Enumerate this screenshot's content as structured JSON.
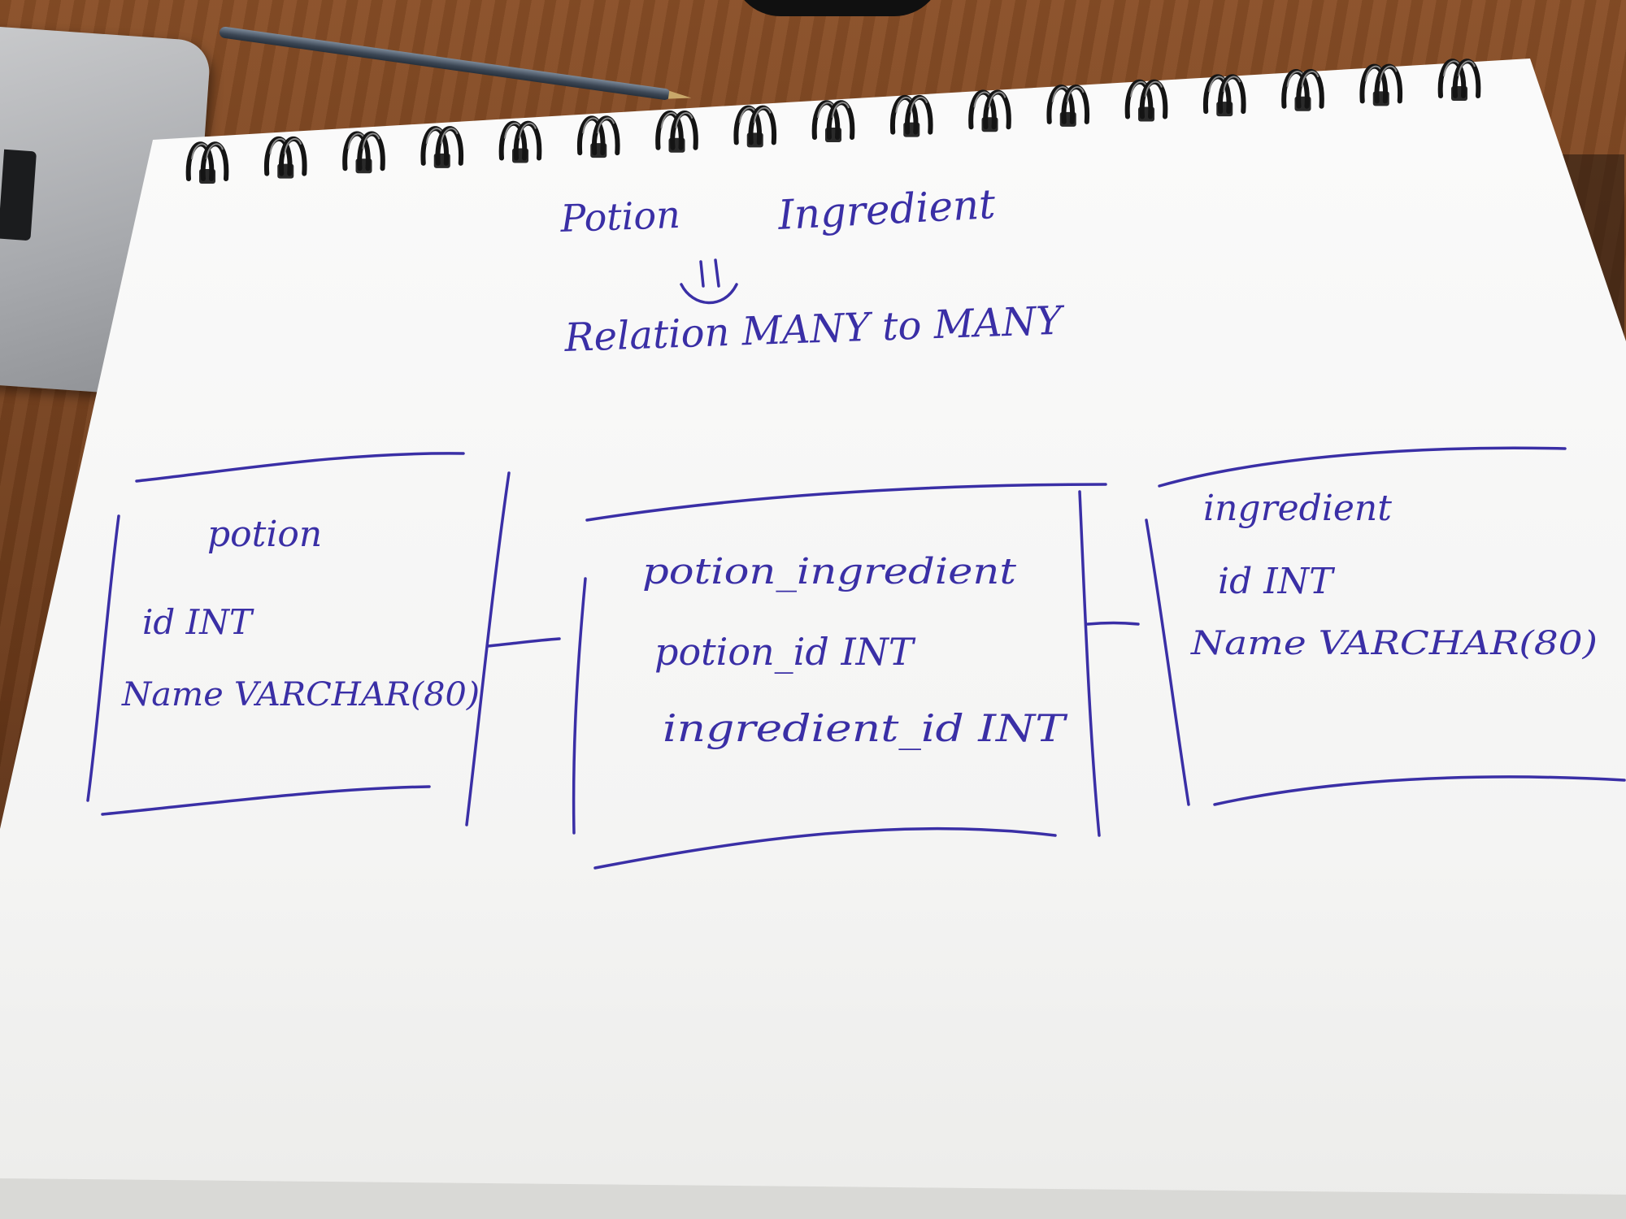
{
  "header": {
    "entity_a": "Potion",
    "entity_b": "Ingredient",
    "relation": "Relation MANY to MANY"
  },
  "tables": {
    "potion": {
      "name": "potion",
      "fields": [
        "id INT",
        "Name VARCHAR(80)"
      ]
    },
    "potion_ingredient": {
      "name": "potion_ingredient",
      "fields": [
        "potion_id INT",
        "ingredient_id INT"
      ]
    },
    "ingredient": {
      "name": "ingredient",
      "fields": [
        "id INT",
        "Name VARCHAR(80)"
      ]
    }
  },
  "colors": {
    "ink": "#3a2fa6",
    "paper": "#f7f7f6",
    "desk": "#7a4522"
  }
}
